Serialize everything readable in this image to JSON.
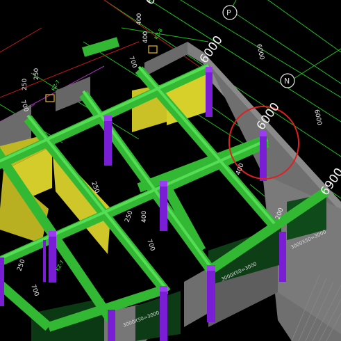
{
  "axes": {
    "p": "P",
    "n": "N"
  },
  "labels": {
    "span1": "6000",
    "span2": "6000",
    "span3": "6900",
    "span4": "600",
    "d400a": "400",
    "d400b": "400",
    "d400c": "400",
    "d400d": "400",
    "d007a": "700",
    "d007b": "700",
    "d007c": "700",
    "d007d": "700",
    "d250a": "250",
    "d250b": "250",
    "d250c": "250",
    "d250d": "250",
    "d250e": "250",
    "d200": "200",
    "d6000a": "6000",
    "d6000b": "6000",
    "kz8": "KZ-8",
    "kz7": "KZ-7",
    "kz7b": "KZ-7",
    "wall1": "3000X50=3000",
    "wall2": "3000X50=3000",
    "wall3": "3000X50=3000"
  },
  "colors": {
    "background": "#000000",
    "beam": "#33b833",
    "column": "#7a1ed6",
    "slab": "#d8d02a",
    "wall": "#7a7a7a",
    "highlight": "#e02020"
  }
}
